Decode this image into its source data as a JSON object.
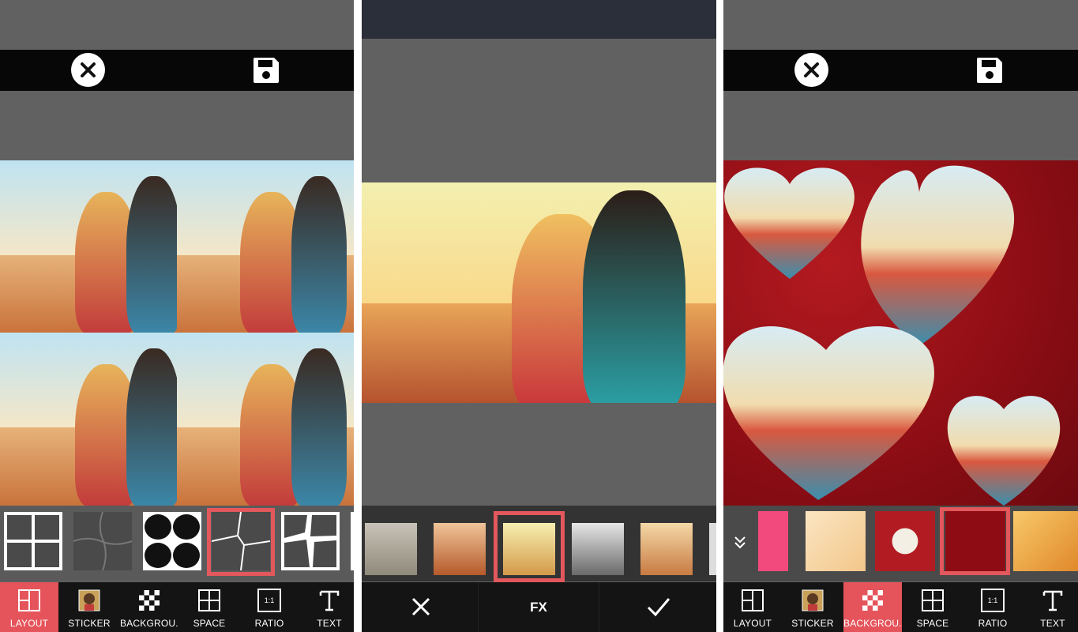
{
  "panel_layout": {
    "nav": [
      {
        "label": "LAYOUT",
        "icon": "layout-icon",
        "active": true
      },
      {
        "label": "STICKER",
        "icon": "sticker-icon",
        "active": false
      },
      {
        "label": "BACKGROU...",
        "icon": "checkerboard-icon",
        "active": false
      },
      {
        "label": "SPACE",
        "icon": "space-icon",
        "active": false
      },
      {
        "label": "RATIO",
        "icon": "ratio-icon",
        "active": false
      },
      {
        "label": "TEXT",
        "icon": "text-icon",
        "active": false
      }
    ],
    "layouts": [
      "grid-2x2",
      "puzzle-curved",
      "rounded-blobs",
      "pinwheel",
      "angled-pieces"
    ],
    "selected_layout_index": 3
  },
  "panel_fx": {
    "filters": [
      "vintage",
      "warm-orange",
      "sunny",
      "black-white",
      "bright"
    ],
    "selected_filter_index": 2,
    "label": "FX"
  },
  "panel_background": {
    "nav": [
      {
        "label": "LAYOUT",
        "icon": "layout-icon",
        "active": false
      },
      {
        "label": "STICKER",
        "icon": "sticker-icon",
        "active": false
      },
      {
        "label": "BACKGROU...",
        "icon": "checkerboard-icon",
        "active": true
      },
      {
        "label": "SPACE",
        "icon": "space-icon",
        "active": false
      },
      {
        "label": "RATIO",
        "icon": "ratio-icon",
        "active": false
      },
      {
        "label": "TEXT",
        "icon": "text-icon",
        "active": false
      }
    ],
    "backgrounds": [
      "pink-pattern",
      "kitchen-pattern",
      "red-white-roses",
      "red-roses",
      "tigers"
    ],
    "selected_background_index": 3
  },
  "ratio_icon_text": "1:1",
  "colors": {
    "accent": "#e5545b",
    "dark": "#141414",
    "panel": "#616161"
  }
}
